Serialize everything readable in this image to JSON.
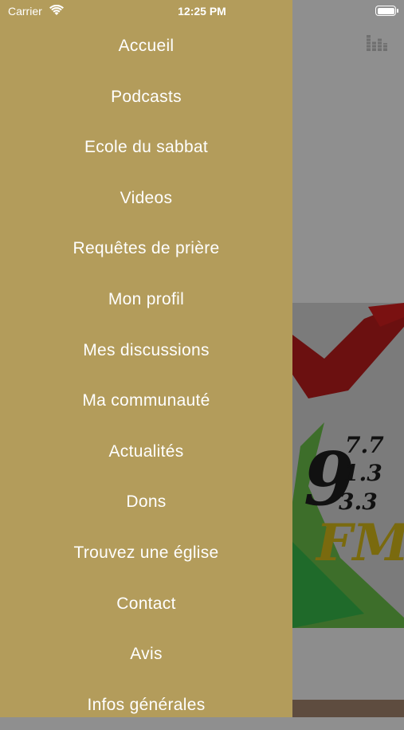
{
  "status_bar": {
    "carrier": "Carrier",
    "time": "12:25 PM"
  },
  "background": {
    "frequencies": [
      "97.7",
      "91.3",
      "93.3"
    ],
    "freq_display": {
      "big": "9",
      "lines": [
        "7.7",
        "1.3",
        "3.3"
      ]
    },
    "fm_label": "FM"
  },
  "drawer": {
    "background_color": "#b39c5b",
    "items": [
      {
        "label": "Accueil"
      },
      {
        "label": "Podcasts"
      },
      {
        "label": "Ecole du sabbat"
      },
      {
        "label": "Videos"
      },
      {
        "label": "Requêtes de prière"
      },
      {
        "label": "Mon profil"
      },
      {
        "label": "Mes discussions"
      },
      {
        "label": "Ma communauté"
      },
      {
        "label": "Actualités"
      },
      {
        "label": "Dons"
      },
      {
        "label": "Trouvez une église"
      },
      {
        "label": "Contact"
      },
      {
        "label": "Avis"
      },
      {
        "label": "Infos générales"
      }
    ]
  },
  "icons": {
    "equalizer": "equalizer-icon",
    "wifi": "wifi-icon",
    "battery": "battery-icon"
  }
}
